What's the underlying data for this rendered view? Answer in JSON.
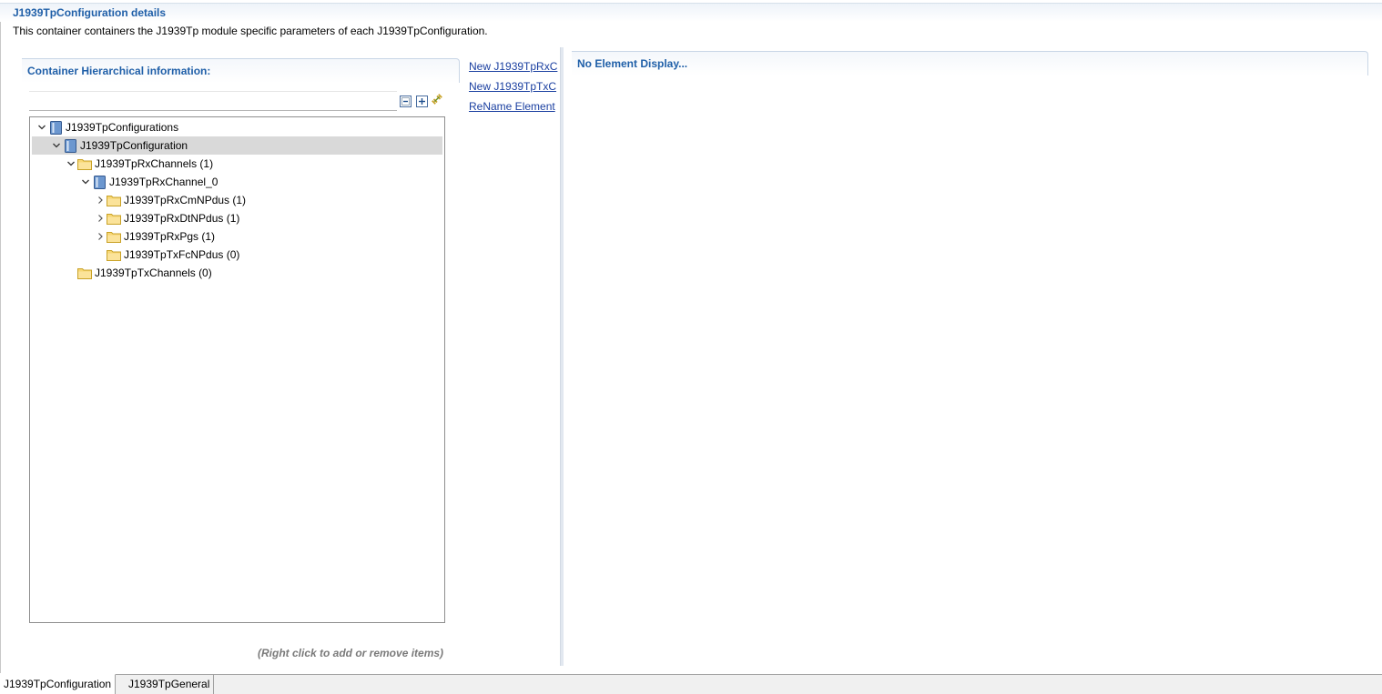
{
  "header": {
    "title": "J1939TpConfiguration details",
    "description": "This container containers the J1939Tp module specific parameters of each J1939TpConfiguration."
  },
  "left_panel": {
    "title": "Container Hierarchical information:",
    "filter_value": "",
    "hint": "(Right click to add or remove items)",
    "toolbar": [
      "collapse-all-icon",
      "expand-all-icon",
      "link-with-editor-icon"
    ]
  },
  "tree": {
    "items": [
      {
        "label": "J1939TpConfigurations",
        "depth": 0,
        "icon": "container-icon",
        "expanded": true
      },
      {
        "label": "J1939TpConfiguration",
        "depth": 1,
        "icon": "container-icon",
        "expanded": true,
        "selected": true
      },
      {
        "label": "J1939TpRxChannels (1)",
        "depth": 2,
        "icon": "folder-icon",
        "expanded": true
      },
      {
        "label": "J1939TpRxChannel_0",
        "depth": 3,
        "icon": "container-icon",
        "expanded": true
      },
      {
        "label": "J1939TpRxCmNPdus (1)",
        "depth": 4,
        "icon": "folder-icon",
        "expanded": false
      },
      {
        "label": "J1939TpRxDtNPdus (1)",
        "depth": 4,
        "icon": "folder-icon",
        "expanded": false
      },
      {
        "label": "J1939TpRxPgs (1)",
        "depth": 4,
        "icon": "folder-icon",
        "expanded": false
      },
      {
        "label": "J1939TpTxFcNPdus (0)",
        "depth": 4,
        "icon": "folder-icon",
        "expanded": null
      },
      {
        "label": "J1939TpTxChannels (0)",
        "depth": 2,
        "icon": "folder-icon",
        "expanded": null
      }
    ]
  },
  "actions": {
    "links": [
      "New J1939TpRxC",
      "New J1939TpTxC",
      "ReName Element"
    ]
  },
  "right_panel": {
    "title": "No Element Display..."
  },
  "tabs": [
    {
      "label": "J1939TpConfiguration",
      "active": true
    },
    {
      "label": "J1939TpGeneral",
      "active": false
    }
  ],
  "colors": {
    "title_blue": "#1f5fa8",
    "link_blue": "#1a3fa0",
    "selected_row": "#d9d9d9",
    "folder_yellow": "#f3cf5b",
    "container_blue": "#5b86c2"
  }
}
